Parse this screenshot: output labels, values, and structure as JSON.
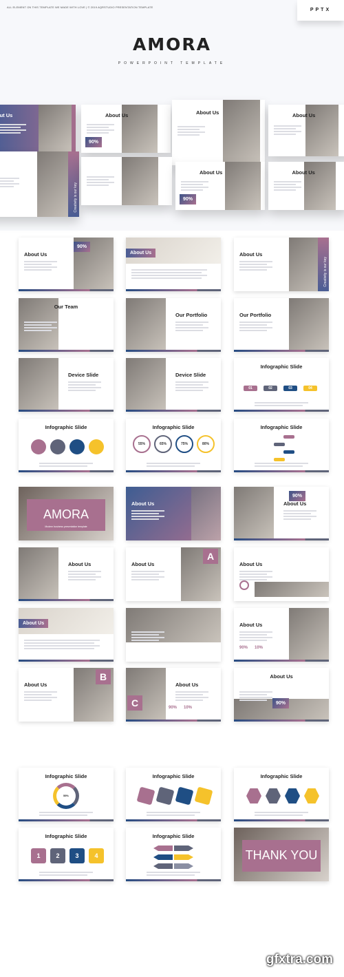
{
  "header": {
    "credit": "ALL ELEMENT ON THIS TEMPLATE WE MADE WITH LOVE | © 2019 AQRSTUDIO PRESENTATION TEMPLATE",
    "format_badge": "PPTX",
    "brand": "AMORA",
    "tagline": "POWERPOINT TEMPLATE"
  },
  "colors": {
    "pink": "#a8708f",
    "slate": "#5f6479",
    "navy": "#1f4e84",
    "yellow": "#f5c22b"
  },
  "hero": {
    "cards": [
      {
        "title": "out Us"
      },
      {
        "title": "About Us",
        "percent": "90%"
      },
      {
        "title": "About Us"
      },
      {
        "title": "About Us"
      },
      {
        "title": "t Us",
        "side_text": "Creativity is our key"
      },
      {
        "title": ""
      },
      {
        "title": "About Us",
        "percent": "90%"
      },
      {
        "title": "About Us"
      }
    ]
  },
  "slides": [
    {
      "title": "About Us",
      "variant": "photo-right",
      "percent": "90%"
    },
    {
      "title": "About Us",
      "variant": "label-photo"
    },
    {
      "title": "About Us",
      "variant": "side",
      "side_text": "Creativity is our key"
    },
    {
      "title": "Our Team",
      "variant": "team"
    },
    {
      "title": "Our Portfolio",
      "variant": "photo-left"
    },
    {
      "title": "Our Portfolio",
      "variant": "portfolio"
    },
    {
      "title": "Device Slide",
      "variant": "device"
    },
    {
      "title": "Device Slide",
      "variant": "phone"
    },
    {
      "title": "Infographic Slide",
      "variant": "info-tabs",
      "shapes": [
        "01",
        "02",
        "03",
        "04"
      ]
    },
    {
      "title": "Infographic Slide",
      "variant": "info-circles",
      "shapes": [
        "",
        "",
        "",
        ""
      ]
    },
    {
      "title": "Infographic Slide",
      "variant": "info-rings",
      "shapes": [
        "55%",
        "65%",
        "75%",
        "80%"
      ]
    },
    {
      "title": "Infographic Slide",
      "variant": "timeline"
    },
    {
      "title": "",
      "variant": "cover",
      "big_text": "AMORA",
      "subtitle": "Modern business presentation template"
    },
    {
      "title": "About Us",
      "variant": "dark-photo"
    },
    {
      "title": "About Us",
      "variant": "photo-left",
      "percent": "90%"
    },
    {
      "title": "About Us",
      "variant": "photo-left"
    },
    {
      "title": "About Us",
      "variant": "letter",
      "letter": "A"
    },
    {
      "title": "About Us",
      "variant": "magnifier"
    },
    {
      "title": "About Us",
      "variant": "label-photo"
    },
    {
      "title": "",
      "variant": "collage"
    },
    {
      "title": "About Us",
      "variant": "photo-right",
      "percents": [
        "90%",
        "10%"
      ]
    },
    {
      "title": "About Us",
      "variant": "letter",
      "letter": "B"
    },
    {
      "title": "About Us",
      "variant": "photo-left",
      "letter": "C",
      "percents": [
        "90%",
        "10%"
      ]
    },
    {
      "title": "About Us",
      "variant": "bottom-photos",
      "percent": "90%"
    },
    {
      "title": "Infographic Slide",
      "variant": "info-donut",
      "center": "55%"
    },
    {
      "title": "Infographic Slide",
      "variant": "info-diamonds",
      "shapes": [
        "",
        "",
        "",
        ""
      ]
    },
    {
      "title": "Infographic Slide",
      "variant": "info-hex",
      "shapes": [
        "",
        "",
        "",
        ""
      ]
    },
    {
      "title": "Infographic Slide",
      "variant": "info-numbers",
      "shapes": [
        "1",
        "2",
        "3",
        "4"
      ]
    },
    {
      "title": "Infographic Slide",
      "variant": "info-arrows"
    },
    {
      "title": "",
      "variant": "cover",
      "big_text": "THANK YOU"
    }
  ],
  "watermark": "gfxtra.com"
}
